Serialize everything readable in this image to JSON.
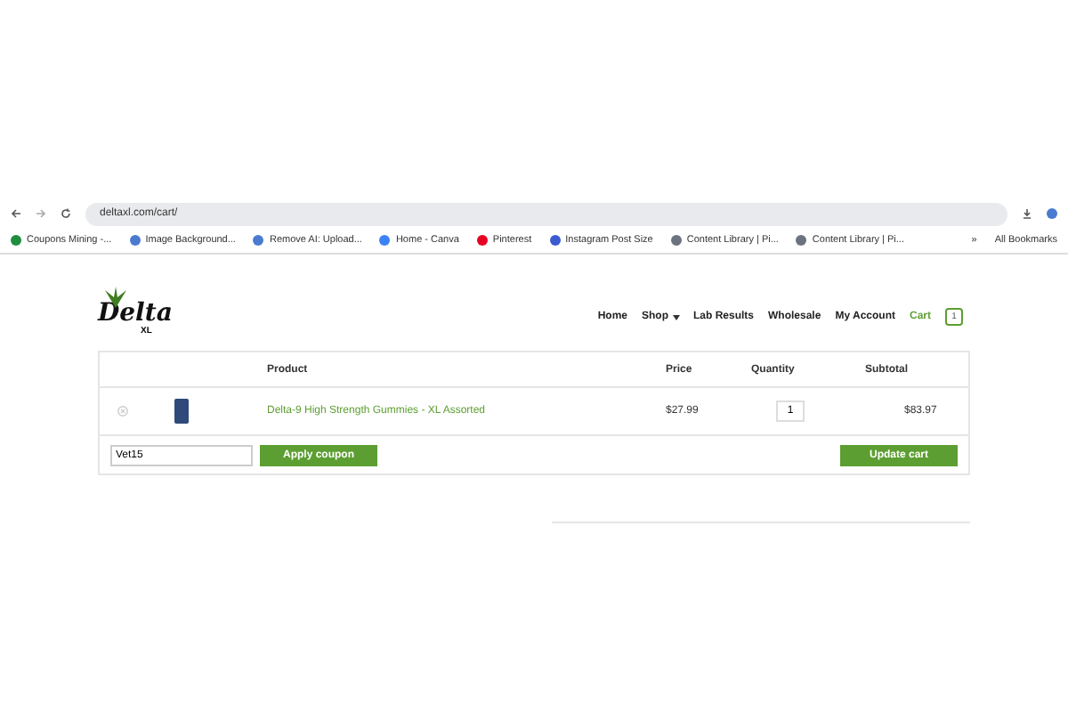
{
  "browser": {
    "url": "deltaxl.com/cart/",
    "bookmarks": [
      {
        "label": "Coupons Mining -...",
        "color": "#1e8e3e"
      },
      {
        "label": "Image Background...",
        "color": "#4a7bd0"
      },
      {
        "label": "Remove AI: Upload...",
        "color": "#4a7bd0"
      },
      {
        "label": "Home - Canva",
        "color": "#3b82f6"
      },
      {
        "label": "Pinterest",
        "color": "#e60023"
      },
      {
        "label": "Instagram Post Size",
        "color": "#3b5bd0"
      },
      {
        "label": "Content Library | Pi...",
        "color": "#6b7280"
      },
      {
        "label": "Content Library | Pi...",
        "color": "#6b7280"
      }
    ],
    "more": "»",
    "all_bookmarks": "All Bookmarks"
  },
  "site": {
    "logo": "Delta",
    "logo_sub": "XL",
    "nav": [
      {
        "label": "Home",
        "selected": false
      },
      {
        "label": "Shop",
        "selected": false,
        "dropdown": true
      },
      {
        "label": "Lab Results",
        "selected": false
      },
      {
        "label": "Wholesale",
        "selected": false
      },
      {
        "label": "My Account",
        "selected": false
      },
      {
        "label": "Cart",
        "selected": true
      }
    ],
    "cart_count": "1"
  },
  "cart": {
    "columns": [
      "Product",
      "Price",
      "Quantity",
      "Subtotal"
    ],
    "rows": [
      {
        "product": "Delta-9 High Strength Gummies - XL Assorted",
        "price": "$27.99",
        "quantity": "1",
        "subtotal": "$83.97"
      }
    ],
    "coupon": {
      "value": "Vet15"
    },
    "apply_button": "Apply coupon",
    "update_button": "Update cart"
  }
}
